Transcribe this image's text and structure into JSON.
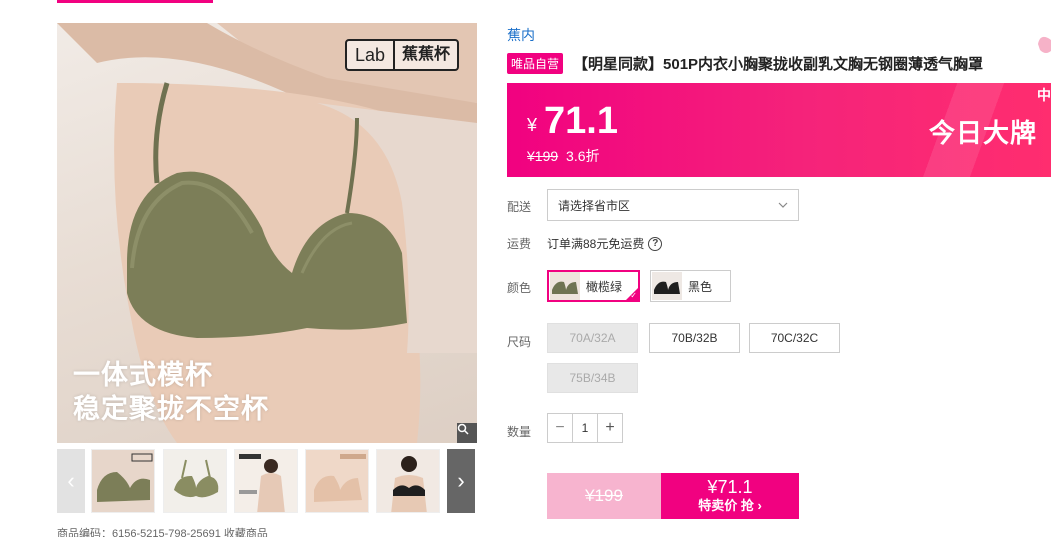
{
  "gallery": {
    "brand_lab": "Lab",
    "brand_cn": "蕉蕉杯",
    "overlay_line1": "一体式模杯",
    "overlay_line2": "稳定聚拢不空杯",
    "zoom_icon": "magnifier-icon",
    "thumb_prev": "‹",
    "thumb_next": "›",
    "meta": "商品编码：6156-5215-798-25691    收藏商品"
  },
  "product": {
    "brand": "蕉内",
    "badge": "唯品自营",
    "title": "【明星同款】501P内衣小胸聚拢收副乳文胸无钢圈薄透气胸罩"
  },
  "price": {
    "currency": "¥",
    "current": "71.1",
    "original": "¥199",
    "discount": "3.6折",
    "promo_label": "今日大牌",
    "edge_text": "中",
    "accent_color": "#f10180"
  },
  "delivery": {
    "label": "配送",
    "placeholder": "请选择省市区"
  },
  "freight": {
    "label": "运费",
    "text": "订单满88元免运费",
    "help_icon": "?"
  },
  "colors": {
    "label": "颜色",
    "options": [
      {
        "name": "橄榄绿",
        "selected": true,
        "swatch": "#6f7351"
      },
      {
        "name": "黑色",
        "selected": false,
        "swatch": "#1f1f1f"
      }
    ]
  },
  "sizes": {
    "label": "尺码",
    "options": [
      {
        "name": "70A/32A",
        "available": false
      },
      {
        "name": "70B/32B",
        "available": true
      },
      {
        "name": "70C/32C",
        "available": true
      },
      {
        "name": "75B/34B",
        "available": false
      }
    ]
  },
  "quantity": {
    "label": "数量",
    "value": "1",
    "minus": "−",
    "plus": "+"
  },
  "buy": {
    "original": "¥199",
    "price": "¥71.1",
    "label": "特卖价 抢 ›"
  }
}
